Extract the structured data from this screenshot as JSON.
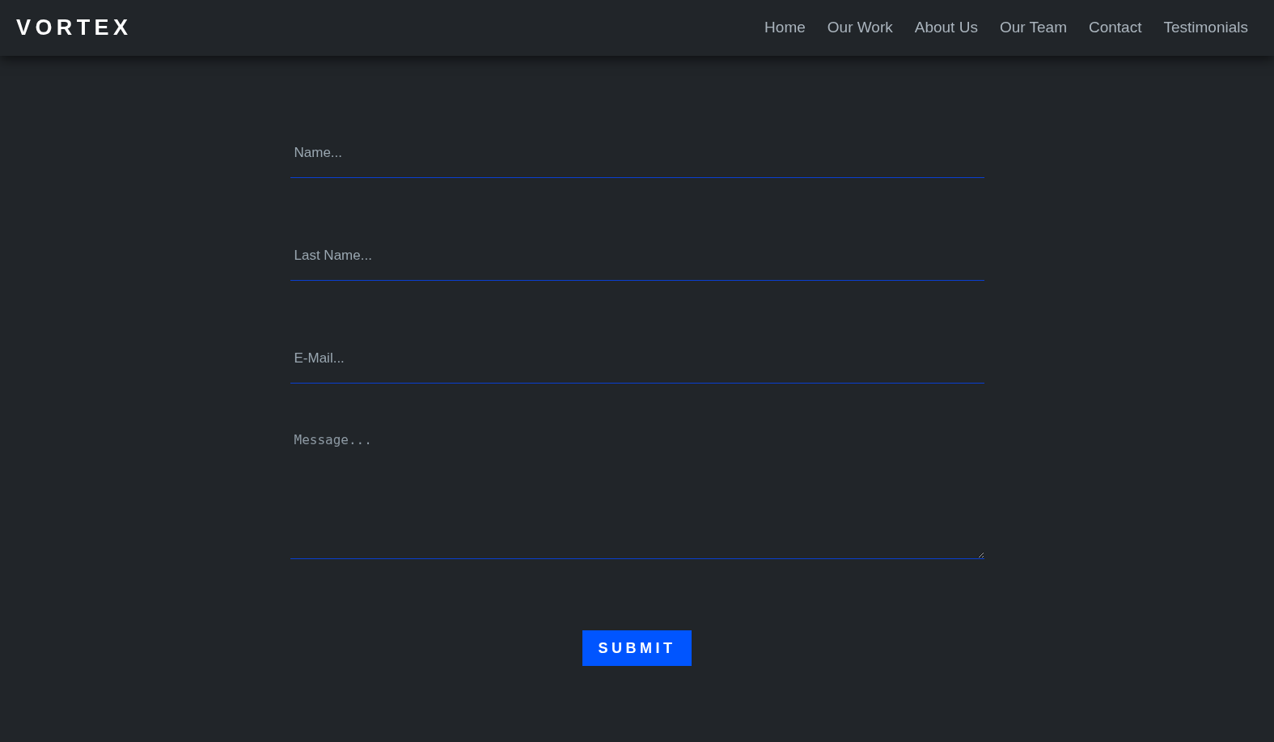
{
  "header": {
    "logo": "VORTEX",
    "nav": [
      {
        "label": "Home"
      },
      {
        "label": "Our Work"
      },
      {
        "label": "About Us"
      },
      {
        "label": "Our Team"
      },
      {
        "label": "Contact"
      },
      {
        "label": "Testimonials"
      }
    ]
  },
  "form": {
    "fields": [
      {
        "kind": "input",
        "placeholder": "Name..."
      },
      {
        "kind": "input",
        "placeholder": "Last Name..."
      },
      {
        "kind": "input",
        "placeholder": "E-Mail..."
      },
      {
        "kind": "textarea",
        "placeholder": "Message..."
      }
    ],
    "submit": "SUBMIT"
  }
}
